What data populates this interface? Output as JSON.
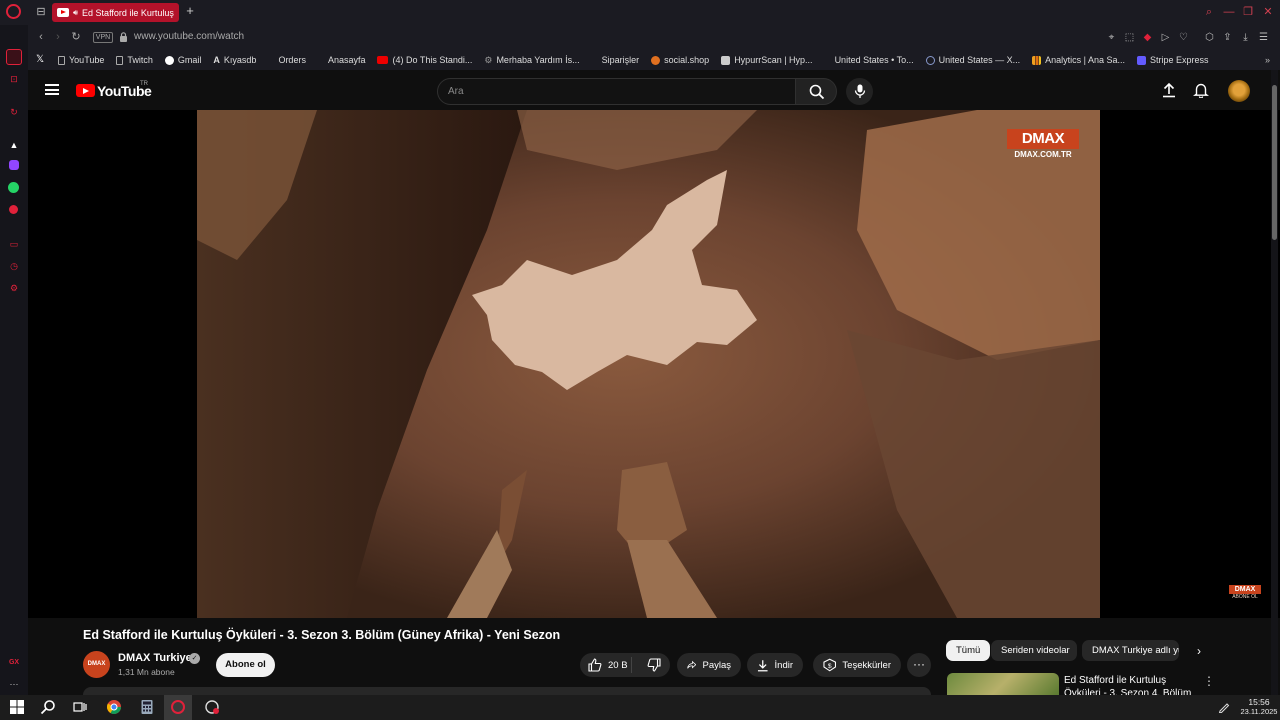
{
  "browser": {
    "active_tab_title": "Ed Stafford ile Kurtuluş",
    "url": "www.youtube.com/watch",
    "vpn_badge": "VPN",
    "new_tab": "+"
  },
  "sidebar": {
    "gx_label": "GX",
    "more_label": "···"
  },
  "bookmarks": [
    {
      "label": "",
      "icon": "x-icon",
      "color": "#ffffff"
    },
    {
      "label": "YouTube",
      "icon": "page-icon",
      "color": "#bbbbbb"
    },
    {
      "label": "Twitch",
      "icon": "page-icon",
      "color": "#bbbbbb"
    },
    {
      "label": "Gmail",
      "icon": "google-icon",
      "color": "#ffffff"
    },
    {
      "label": "Kıyasdb",
      "icon": "a-icon",
      "color": "#dddddd"
    },
    {
      "label": "Orders",
      "icon": "blank-icon",
      "color": "#1b1b22"
    },
    {
      "label": "Anasayfa",
      "icon": "blank-icon",
      "color": "#1b1b22"
    },
    {
      "label": "(4) Do This Standi...",
      "icon": "youtube-icon",
      "color": "#e00000"
    },
    {
      "label": "Merhaba Yardım İs...",
      "icon": "gear-icon",
      "color": "#999999"
    },
    {
      "label": "Siparişler",
      "icon": "blank-icon",
      "color": "#1b1b22"
    },
    {
      "label": "social.shop",
      "icon": "social-icon",
      "color": "#e07020"
    },
    {
      "label": "HypurrScan | Hyp...",
      "icon": "hypurr-icon",
      "color": "#cccccc"
    },
    {
      "label": "United States • To...",
      "icon": "blank-icon",
      "color": "#1b1b22"
    },
    {
      "label": "United States — X...",
      "icon": "globe-icon",
      "color": "#8899cc"
    },
    {
      "label": "Analytics | Ana Sa...",
      "icon": "analytics-icon",
      "color": "#f0a020"
    },
    {
      "label": "Stripe Express",
      "icon": "stripe-icon",
      "color": "#635bff"
    }
  ],
  "youtube": {
    "logo_text": "YouTube",
    "country_code": "TR",
    "search_placeholder": "Ara"
  },
  "video": {
    "channel_logo_big": "DMAX",
    "channel_logo_small": "DMAX.COM.TR",
    "watermark_big": "DMAX",
    "watermark_small": "ABONE OL",
    "title": "Ed Stafford ile Kurtuluş Öyküleri - 3. Sezon 3. Bölüm (Güney Afrika) - Yeni Sezon"
  },
  "channel": {
    "avatar_text": "DMAX",
    "name": "DMAX Turkiye",
    "subscribers": "1,31 Mn abone",
    "subscribe_label": "Abone ol"
  },
  "actions": {
    "likes": "20 B",
    "share": "Paylaş",
    "download": "İndir",
    "thanks": "Teşekkürler",
    "more": "···"
  },
  "chips": [
    "Tümü",
    "Seriden videolar",
    "DMAX Turkiye adlı yüklemeler"
  ],
  "recommendation": {
    "title": "Ed Stafford ile Kurtuluş Öyküleri - 3. Sezon 4. Bölüm"
  },
  "taskbar": {
    "time": "15:56",
    "date": "23.11.2025"
  }
}
